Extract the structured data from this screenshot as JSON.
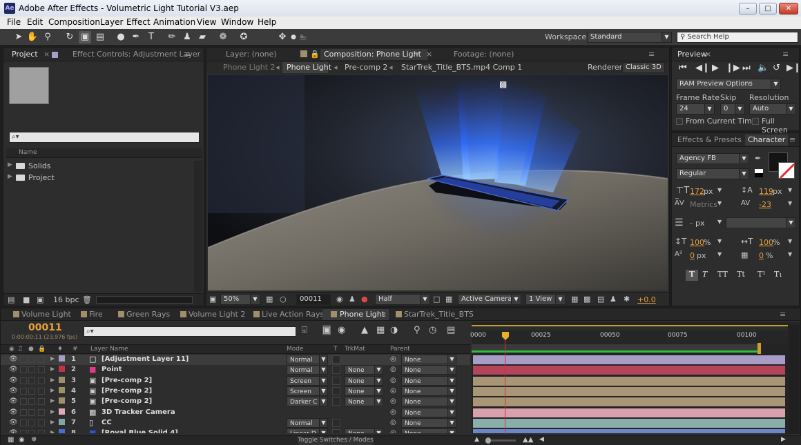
{
  "window": {
    "title": "Adobe After Effects - Volumetric Light Tutorial V3.aep",
    "app_icon": "Ae"
  },
  "menu": [
    "File",
    "Edit",
    "Composition",
    "Layer",
    "Effect",
    "Animation",
    "View",
    "Window",
    "Help"
  ],
  "toolbar": {
    "workspace_label": "Workspace:",
    "workspace_value": "Standard",
    "search_placeholder": "Search Help"
  },
  "project": {
    "tab_project": "Project",
    "tab_effects": "Effect Controls: Adjustment Layer",
    "search_placeholder": "⌕▾",
    "column_name": "Name",
    "items": [
      "Solids",
      "Project"
    ],
    "bpc": "16 bpc"
  },
  "viewer": {
    "tab_layer": "Layer: (none)",
    "tab_comp": "Composition: Phone Light",
    "tab_footage": "Footage: (none)",
    "breadcrumbs": [
      "Phone Light 2",
      "Phone Light",
      "Pre-comp 2",
      "StarTrek_Title_BTS.mp4 Comp 1"
    ],
    "renderer_label": "Renderer:",
    "renderer_value": "Classic 3D",
    "zoom": "50%",
    "timecode": "00011",
    "resolution": "Half",
    "camera": "Active Camera",
    "views": "1 View",
    "exposure": "+0.0"
  },
  "preview": {
    "tab": "Preview",
    "ram_options": "RAM Preview Options",
    "frame_rate_label": "Frame Rate",
    "skip_label": "Skip",
    "resolution_label": "Resolution",
    "frame_rate": "24",
    "skip": "0",
    "resolution": "Auto",
    "from_current": "From Current Time",
    "full_screen": "Full Screen"
  },
  "character": {
    "tab_effects": "Effects & Presets",
    "tab_char": "Character",
    "font": "Agency FB",
    "style": "Regular",
    "font_size": "172",
    "leading": "119",
    "px": "px",
    "kerning": "Metrics",
    "tracking": "-23",
    "stroke_width": "-",
    "vscale": "100",
    "hscale": "100",
    "baseline": "0",
    "tsume": "0",
    "pct": "%",
    "format_buttons": [
      "T",
      "T",
      "TT",
      "Tt",
      "T¹",
      "T₁"
    ]
  },
  "timeline": {
    "tabs": [
      "Volume Light",
      "Fire",
      "Green Rays",
      "Volume Light 2",
      "Live Action Rays",
      "Phone Light",
      "StarTrek_Title_BTS"
    ],
    "timecode": "00011",
    "timecode_sub": "0:00:00:11 (23.976 fps)",
    "search_placeholder": "⌕▾",
    "col_layer": "Layer Name",
    "col_mode": "Mode",
    "col_t": "T",
    "col_trkmat": "TrkMat",
    "col_parent": "Parent",
    "ruler": [
      "0000",
      "00025",
      "00050",
      "00075",
      "00100"
    ],
    "toggle": "Toggle Switches / Modes",
    "layers": [
      {
        "num": "1",
        "name": "[Adjustment Layer 11]",
        "mode": "Normal",
        "trk": "",
        "parent": "None",
        "color": "#a79dc6",
        "icon": "white",
        "bar": "#a79dc6"
      },
      {
        "num": "2",
        "name": "Point",
        "mode": "Normal",
        "trk": "None",
        "parent": "None",
        "color": "#c4324a",
        "icon": "pink",
        "bar": "#b5445a"
      },
      {
        "num": "3",
        "name": "[Pre-comp 2]",
        "mode": "Screen",
        "trk": "None",
        "parent": "None",
        "color": "#a0906a",
        "icon": "comp",
        "bar": "#a89676"
      },
      {
        "num": "4",
        "name": "[Pre-comp 2]",
        "mode": "Screen",
        "trk": "None",
        "parent": "None",
        "color": "#a0906a",
        "icon": "comp",
        "bar": "#a89676"
      },
      {
        "num": "5",
        "name": "[Pre-comp 2]",
        "mode": "Darker C",
        "trk": "None",
        "parent": "None",
        "color": "#a0906a",
        "icon": "comp",
        "bar": "#a89676"
      },
      {
        "num": "6",
        "name": "3D Tracker Camera",
        "mode": "",
        "trk": "",
        "parent": "None",
        "color": "#e2a9b5",
        "icon": "cam",
        "bar": "#d9a0ae"
      },
      {
        "num": "7",
        "name": "CC",
        "mode": "Normal",
        "trk": "",
        "parent": "None",
        "color": "#7fa8a4",
        "icon": "file",
        "bar": "#8aaea9"
      },
      {
        "num": "8",
        "name": "[Royal Blue Solid 4]",
        "mode": "Linear D",
        "trk": "None",
        "parent": "None",
        "color": "#4a6bd4",
        "icon": "blue",
        "bar": "#6c86c9"
      }
    ]
  },
  "colors": {
    "accent": "#e6a03a",
    "ui_bg": "#2d2d2d",
    "playhead": "#d03030"
  }
}
